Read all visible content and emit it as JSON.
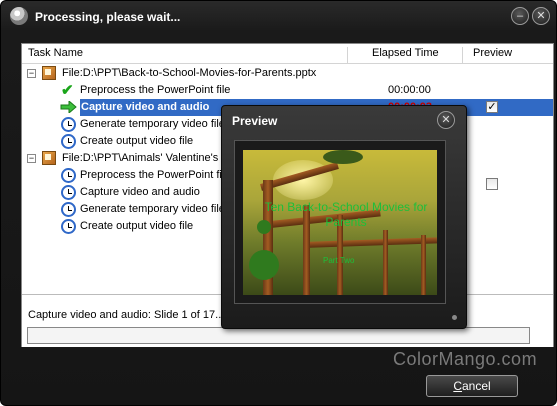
{
  "window": {
    "title": "Processing, please wait...",
    "minimize_glyph": "–",
    "close_glyph": "✕"
  },
  "table": {
    "columns": [
      "Task Name",
      "Elapsed Time",
      "Preview"
    ],
    "rows": [
      {
        "type": "file",
        "label": "File:D:\\PPT\\Back-to-School-Movies-for-Parents.pptx",
        "time": "",
        "preview": null
      },
      {
        "type": "task",
        "icon": "check-icon",
        "label": "Preprocess the PowerPoint file",
        "time": "00:00:00",
        "preview": null
      },
      {
        "type": "task",
        "icon": "arrow-right-icon",
        "label": "Capture video and audio",
        "time": "00:00:03",
        "preview": true,
        "selected": true
      },
      {
        "type": "task",
        "icon": "clock-icon",
        "label": "Generate temporary video file",
        "time": "",
        "preview": null
      },
      {
        "type": "task",
        "icon": "clock-icon",
        "label": "Create output video file",
        "time": "",
        "preview": null
      },
      {
        "type": "file",
        "label": "File:D:\\PPT\\Animals' Valentine's Day.pptx",
        "time": "",
        "preview": false
      },
      {
        "type": "task",
        "icon": "clock-icon",
        "label": "Preprocess the PowerPoint file",
        "time": "",
        "preview": null
      },
      {
        "type": "task",
        "icon": "clock-icon",
        "label": "Capture video and audio",
        "time": "",
        "preview": null
      },
      {
        "type": "task",
        "icon": "clock-icon",
        "label": "Generate temporary video file",
        "time": "",
        "preview": null
      },
      {
        "type": "task",
        "icon": "clock-icon",
        "label": "Create output video file",
        "time": "",
        "preview": null
      }
    ]
  },
  "status": {
    "text": "Capture video and audio: Slide 1 of 17...",
    "progress": 0
  },
  "preview_window": {
    "title": "Preview",
    "close_glyph": "✕",
    "slide_title": "Ten Back-to-School Movies for Parents",
    "slide_subtitle": "Part Two"
  },
  "watermark": "ColorMango.com",
  "buttons": {
    "cancel_prefix": "",
    "cancel_underlined": "C",
    "cancel_rest": "ancel"
  },
  "colors": {
    "selection": "#316ac5",
    "elapsed_active": "#cc0000",
    "slide_text": "#1dbf3a"
  }
}
